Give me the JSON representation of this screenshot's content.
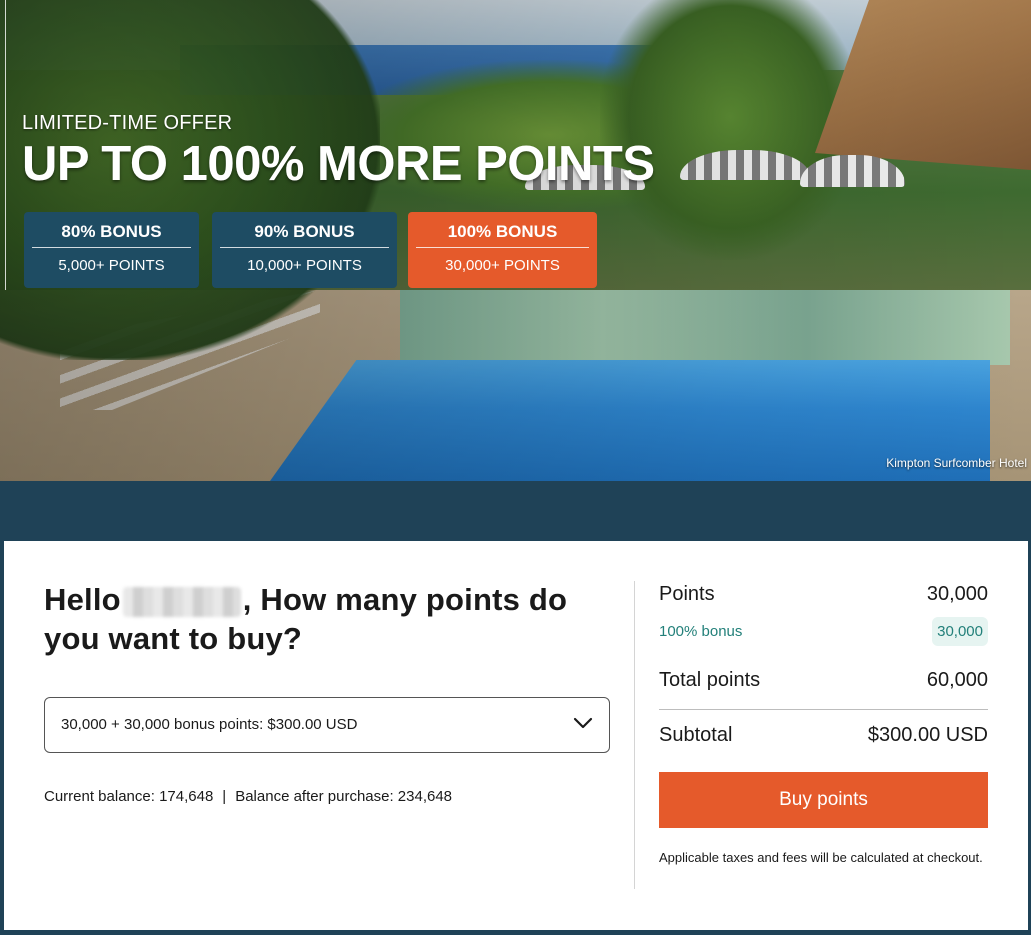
{
  "hero": {
    "kicker": "LIMITED-TIME OFFER",
    "title": "UP TO 100% MORE POINTS",
    "photo_credit": "Kimpton Surfcomber Hotel",
    "tiers": [
      {
        "bonus": "80% BONUS",
        "threshold": "5,000+ POINTS",
        "color": "#1e4c63"
      },
      {
        "bonus": "90% BONUS",
        "threshold": "10,000+ POINTS",
        "color": "#1e4c63"
      },
      {
        "bonus": "100% BONUS",
        "threshold": "30,000+ POINTS",
        "color": "#e55a2b"
      }
    ]
  },
  "form": {
    "greeting_prefix": "Hello",
    "greeting_suffix": ", How many points do you want to buy?",
    "select_value": "30,000 + 30,000 bonus points: $300.00 USD",
    "current_balance": "Current balance: 174,648",
    "balance_separator": "|",
    "balance_after": "Balance after purchase: 234,648"
  },
  "summary": {
    "points_label": "Points",
    "points_value": "30,000",
    "bonus_label": "100% bonus",
    "bonus_value": "30,000",
    "total_label": "Total points",
    "total_value": "60,000",
    "subtotal_label": "Subtotal",
    "subtotal_value": "$300.00 USD",
    "buy_button": "Buy points",
    "tax_note": "Applicable taxes and fees will be calculated at checkout."
  },
  "colors": {
    "brand_dark": "#1f4257",
    "accent": "#e55a2b",
    "bonus_teal": "#23807a"
  }
}
